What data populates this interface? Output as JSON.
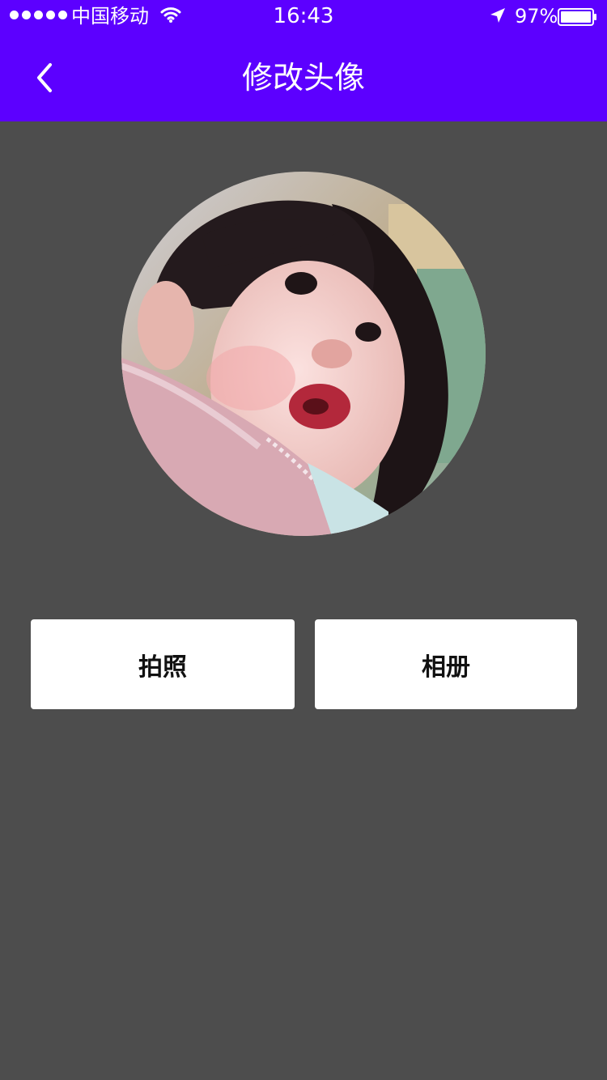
{
  "status_bar": {
    "carrier": "中国移动",
    "time": "16:43",
    "battery": "97%"
  },
  "header": {
    "title": "修改头像",
    "back_icon": "chevron-left-icon"
  },
  "avatar": {
    "icon": "avatar-photo"
  },
  "actions": {
    "camera_label": "拍照",
    "album_label": "相册"
  },
  "colors": {
    "header": "#5c00ff",
    "background": "#4d4d4d",
    "button": "#ffffff"
  }
}
